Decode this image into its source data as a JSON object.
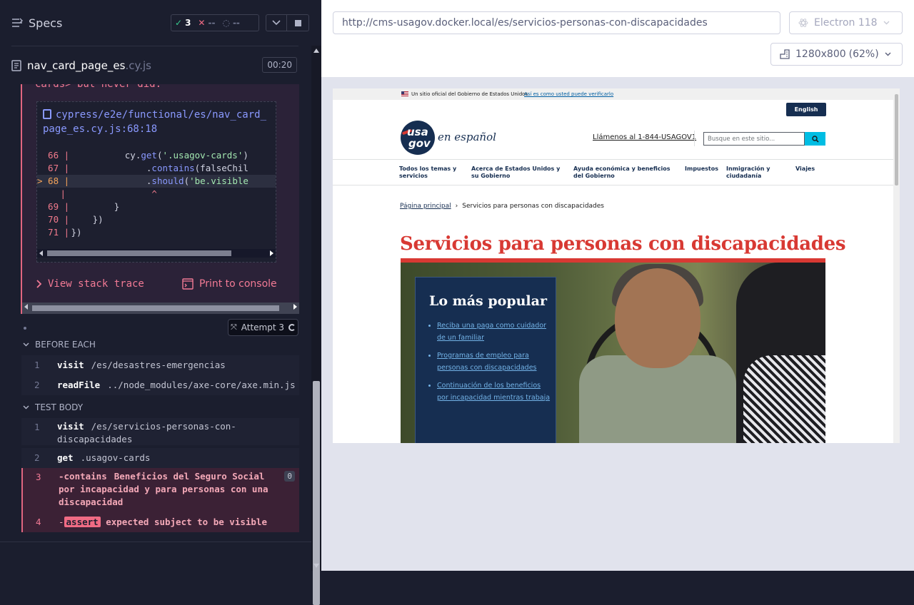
{
  "reporter": {
    "title": "Specs",
    "stats": {
      "passed": "3",
      "failed": "--",
      "pending": "--"
    },
    "file_name": "nav_card_page_es",
    "file_ext": ".cy.js",
    "duration": "00:20",
    "error": {
      "message": "cards> but never did.",
      "path_line1": "cypress/e2e/functional/es/nav_card_",
      "path_line2": "page_es.cy.js:68:18",
      "code_lines": [
        {
          "num": "66",
          "pre": "           cy.",
          "fn": "get",
          "p2": "(",
          "str": "'.usagov-cards'",
          "post": ")"
        },
        {
          "num": "67",
          "pre": "               .",
          "fn": "contains",
          "p2": "(falseChil",
          "str": "",
          "post": ""
        },
        {
          "num": "68",
          "pre": "               .",
          "fn": "should",
          "p2": "(",
          "str": "'be.visible",
          "post": ""
        },
        {
          "num": "69",
          "pre": "         }",
          "fn": "",
          "p2": "",
          "str": "",
          "post": ""
        },
        {
          "num": "70",
          "pre": "     })",
          "fn": "",
          "p2": "",
          "str": "",
          "post": ""
        },
        {
          "num": "71",
          "pre": " })",
          "fn": "",
          "p2": "",
          "str": "",
          "post": ""
        }
      ],
      "caret": "^",
      "marker": ">",
      "view_stack": "View stack trace",
      "print_console": "Print to console"
    },
    "attempt": "Attempt 3",
    "before_each": {
      "label": "BEFORE EACH",
      "commands": [
        {
          "n": "1",
          "name": "visit",
          "arg": "/es/desastres-emergencias"
        },
        {
          "n": "2",
          "name": "readFile",
          "arg": "../node_modules/axe-core/axe.min.js"
        }
      ]
    },
    "test_body": {
      "label": "TEST BODY",
      "commands": [
        {
          "n": "1",
          "name": "visit",
          "arg": "/es/servicios-personas-con-discapacidades"
        },
        {
          "n": "2",
          "name": "get",
          "arg": ".usagov-cards"
        },
        {
          "n": "3",
          "name": "-contains",
          "arg": "Beneficios del Seguro Social por incapacidad y para personas con una discapacidad",
          "count": "0"
        },
        {
          "n": "4",
          "name": "-",
          "badge": "assert",
          "arg": "expected subject to be visible"
        }
      ]
    }
  },
  "aut": {
    "url": "http://cms-usagov.docker.local/es/servicios-personas-con-discapacidades",
    "browser": "Electron 118",
    "viewport": "1280x800",
    "zoom": "(62%)"
  },
  "site": {
    "banner_text": "Un sitio oficial del Gobierno de Estados Unidos",
    "banner_link": "Así es como usted puede verificarlo",
    "english_button": "English",
    "logo_usa": "usa",
    "logo_gov": "gov",
    "logo_text": "en español",
    "phone": "Llámenos al 1-844-USAGOV1",
    "search_placeholder": "Busque en este sitio...",
    "nav": [
      "Todos los temas y servicios",
      "Acerca de Estados Unidos y su Gobierno",
      "Ayuda económica y beneficios del Gobierno",
      "Impuestos",
      "Inmigración y ciudadanía",
      "Viajes"
    ],
    "breadcrumb_home": "Página principal",
    "breadcrumb_current": "Servicios para personas con discapacidades",
    "page_title": "Servicios para personas con discapacidades",
    "popular_title": "Lo más popular",
    "popular_links": [
      "Reciba una paga como cuidador de un familiar",
      "Programas de empleo para personas con discapacidades",
      "Continuación de los beneficios por incapacidad mientras trabaja"
    ]
  },
  "colors": {
    "accent_red": "#d83933",
    "navy": "#162e51",
    "fail_pink": "#f27a95"
  }
}
